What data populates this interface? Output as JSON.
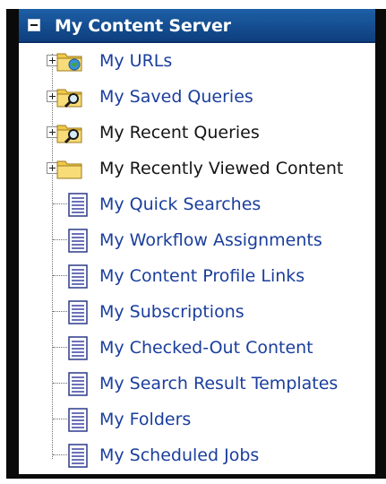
{
  "header": {
    "title": "My Content Server"
  },
  "colors": {
    "header": "#16508f",
    "link": "#1a3e9c",
    "text": "#141414",
    "folder": "#f0c948"
  },
  "folders": [
    {
      "label": "My URLs",
      "style": "link",
      "icon": "folder-globe-icon"
    },
    {
      "label": "My Saved Queries",
      "style": "link",
      "icon": "folder-search-icon"
    },
    {
      "label": "My Recent Queries",
      "style": "plain",
      "icon": "folder-search-icon"
    },
    {
      "label": "My Recently Viewed Content",
      "style": "plain",
      "icon": "folder-icon"
    }
  ],
  "documents": [
    {
      "label": "My Quick Searches"
    },
    {
      "label": "My Workflow Assignments"
    },
    {
      "label": "My Content Profile Links"
    },
    {
      "label": "My Subscriptions"
    },
    {
      "label": "My Checked-Out Content"
    },
    {
      "label": "My Search Result Templates"
    },
    {
      "label": "My Folders"
    },
    {
      "label": "My Scheduled Jobs"
    }
  ]
}
